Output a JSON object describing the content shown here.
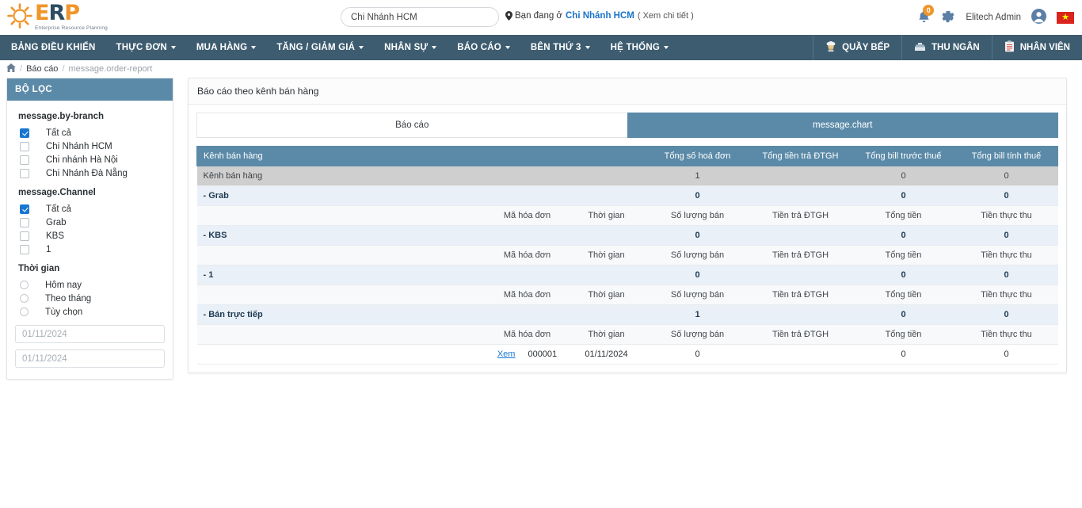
{
  "brand": {
    "name_part1": "E",
    "name_part2": "R",
    "name_part3": "P",
    "tagline": "Enterprise Resource Planning"
  },
  "header": {
    "search_value": "Chi Nhánh HCM",
    "search_placeholder": "Chi Nhánh HCM",
    "location_prefix": "Bạn đang ở",
    "location_branch": "Chi Nhánh HCM",
    "location_detail": "( Xem chi tiết )",
    "notification_count": "0",
    "user_name": "Elitech Admin",
    "flag_star": "★"
  },
  "nav": {
    "items": [
      {
        "label": "BẢNG ĐIỀU KHIỂN",
        "caret": false
      },
      {
        "label": "THỰC ĐƠN",
        "caret": true
      },
      {
        "label": "MUA HÀNG",
        "caret": true
      },
      {
        "label": "TĂNG / GIẢM GIÁ",
        "caret": true
      },
      {
        "label": "NHÂN SỰ",
        "caret": true
      },
      {
        "label": "BÁO CÁO",
        "caret": true
      },
      {
        "label": "BÊN THỨ 3",
        "caret": true
      },
      {
        "label": "HỆ THỐNG",
        "caret": true
      }
    ],
    "right_buttons": [
      {
        "label": "QUẦY BẾP",
        "icon": "chef-hat-icon"
      },
      {
        "label": "THU NGÂN",
        "icon": "cash-register-icon"
      },
      {
        "label": "NHÂN VIÊN",
        "icon": "clipboard-icon"
      }
    ]
  },
  "breadcrumb": {
    "home_icon": "home-icon",
    "sep": "/",
    "level1": "Báo cáo",
    "level2": "message.order-report"
  },
  "sidebar": {
    "title": "BỘ LỌC",
    "groups": [
      {
        "title": "message.by-branch",
        "type": "checkbox",
        "options": [
          {
            "label": "Tất cả",
            "checked": true
          },
          {
            "label": "Chi Nhánh HCM",
            "checked": false
          },
          {
            "label": "Chi nhánh Hà Nội",
            "checked": false
          },
          {
            "label": "Chi Nhánh Đà Nẵng",
            "checked": false
          }
        ]
      },
      {
        "title": "message.Channel",
        "type": "checkbox",
        "options": [
          {
            "label": "Tất cả",
            "checked": true
          },
          {
            "label": "Grab",
            "checked": false
          },
          {
            "label": "KBS",
            "checked": false
          },
          {
            "label": "1",
            "checked": false
          }
        ]
      },
      {
        "title": "Thời gian",
        "type": "radio",
        "options": [
          {
            "label": "Hôm nay",
            "checked": false
          },
          {
            "label": "Theo tháng",
            "checked": false
          },
          {
            "label": "Tùy chọn",
            "checked": false
          }
        ]
      }
    ],
    "date_from_placeholder": "01/11/2024",
    "date_from_value": "",
    "date_to_placeholder": "01/11/2024",
    "date_to_value": ""
  },
  "main": {
    "panel_title": "Báo cáo theo kênh bán hàng",
    "tabs": [
      {
        "label": "Báo cáo",
        "active": false
      },
      {
        "label": "message.chart",
        "active": true
      }
    ],
    "table": {
      "headers": [
        "Kênh bán hàng",
        "",
        "",
        "",
        "Tổng số hoá đơn",
        "Tổng tiền trả ĐTGH",
        "Tổng bill trước thuế",
        "Tổng bill tính thuế"
      ],
      "subheaders": [
        "Mã hóa đơn",
        "Thời gian",
        "Số lượng bán",
        "Tiền trả ĐTGH",
        "Tổng tiền",
        "Tiền thực thu"
      ],
      "rows": [
        {
          "type": "total",
          "cells": [
            "Kênh bán hàng",
            "",
            "",
            "",
            "1",
            "",
            "0",
            "0"
          ]
        },
        {
          "type": "group",
          "cells": [
            "- Grab",
            "",
            "",
            "",
            "0",
            "",
            "0",
            "0"
          ]
        },
        {
          "type": "subhead",
          "cells": [
            "",
            "",
            "Mã hóa đơn",
            "Thời gian",
            "Số lượng bán",
            "Tiền trả ĐTGH",
            "Tổng tiền",
            "Tiền thực thu"
          ]
        },
        {
          "type": "group",
          "cells": [
            "- KBS",
            "",
            "",
            "",
            "0",
            "",
            "0",
            "0"
          ]
        },
        {
          "type": "subhead",
          "cells": [
            "",
            "",
            "Mã hóa đơn",
            "Thời gian",
            "Số lượng bán",
            "Tiền trả ĐTGH",
            "Tổng tiền",
            "Tiền thực thu"
          ]
        },
        {
          "type": "group",
          "cells": [
            "- 1",
            "",
            "",
            "",
            "0",
            "",
            "0",
            "0"
          ]
        },
        {
          "type": "subhead",
          "cells": [
            "",
            "",
            "Mã hóa đơn",
            "Thời gian",
            "Số lượng bán",
            "Tiền trả ĐTGH",
            "Tổng tiền",
            "Tiền thực thu"
          ]
        },
        {
          "type": "group",
          "cells": [
            "- Bán trực tiếp",
            "",
            "",
            "",
            "1",
            "",
            "0",
            "0"
          ]
        },
        {
          "type": "subhead",
          "cells": [
            "",
            "",
            "Mã hóa đơn",
            "Thời gian",
            "Số lượng bán",
            "Tiền trả ĐTGH",
            "Tổng tiền",
            "Tiền thực thu"
          ]
        },
        {
          "type": "data",
          "cells": [
            "",
            "",
            "Xem",
            "000001",
            "01/11/2024",
            "0",
            "",
            "0",
            "0"
          ],
          "link_index": 2
        }
      ]
    }
  },
  "colors": {
    "nav_bg": "#3d5c70",
    "accent_blue": "#5b8aa8",
    "brand_orange": "#f0952a",
    "link_blue": "#1876d2",
    "total_row": "#cfcfcf",
    "group_row": "#eaf0f7"
  }
}
